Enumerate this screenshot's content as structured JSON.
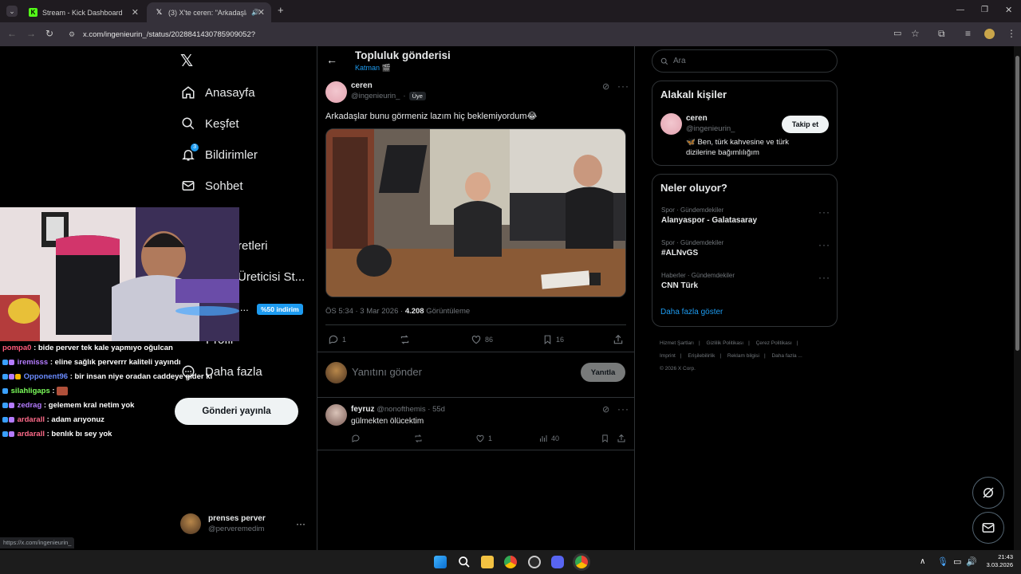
{
  "browser": {
    "tabs": [
      {
        "label": "Stream - Kick Dashboard",
        "active": false
      },
      {
        "label": "(3) X'te ceren: \"Arkadaşlar b",
        "active": true
      }
    ],
    "url": "x.com/ingenieurin_/status/2028841430785909052?",
    "status_url": "https://x.com/ingenieurin_"
  },
  "sidebar": {
    "items": [
      {
        "label": "Anasayfa",
        "icon": "home-icon"
      },
      {
        "label": "Keşfet",
        "icon": "search-icon"
      },
      {
        "label": "Bildirimler",
        "icon": "bell-icon",
        "badge": "3"
      },
      {
        "label": "Sohbet",
        "icon": "mail-icon"
      },
      {
        "label": "retleri"
      },
      {
        "label": "Üreticisi St..."
      },
      {
        "label": "l..."
      },
      {
        "label": "Profil"
      },
      {
        "label": "Daha fazla",
        "icon": "more-circle-icon"
      }
    ],
    "premium_badge": "%50 indirim",
    "post_button": "Gönderi yayınla",
    "account": {
      "name": "prenses perver",
      "handle": "@perveremedim"
    }
  },
  "header": {
    "title": "Topluluk gönderisi",
    "subtitle": "Katman 🎬"
  },
  "post": {
    "name": "ceren",
    "handle": "@ingenieurin_",
    "sep": "·",
    "member_badge": "Üye",
    "text": "Arkadaşlar bunu görmeniz lazım hiç beklemiyordum😂",
    "time": "ÖS 5:34 · 3 Mar 2026 ·",
    "views_count": "4.208",
    "views_label": "Görüntüleme",
    "replies": "1",
    "likes": "86",
    "bookmarks": "16"
  },
  "reply_box": {
    "placeholder": "Yanıtını gönder",
    "button": "Yanıtla"
  },
  "reply": {
    "name": "feyruz",
    "handle": "@nonofthemis · 55d",
    "text": "gülmekten ölücektim",
    "likes": "1",
    "views": "40"
  },
  "right": {
    "search_placeholder": "Ara",
    "related_title": "Alakalı kişiler",
    "related": {
      "name": "ceren",
      "handle": "@ingenieurin_",
      "bio": "🦋 Ben, türk kahvesine ve türk dizilerine bağımlılığım",
      "follow": "Takip et"
    },
    "trends_title": "Neler oluyor?",
    "trends": [
      {
        "meta": "Spor · Gündemdekiler",
        "name": "Alanyaspor - Galatasaray"
      },
      {
        "meta": "Spor · Gündemdekiler",
        "name": "#ALNvGS"
      },
      {
        "meta": "Haberler · Gündemdekiler",
        "name": "CNN Türk"
      }
    ],
    "show_more": "Daha fazla göster",
    "footer": [
      "Hizmet Şartları",
      "Gizlilik Politikası",
      "Çerez Politikası",
      "Imprint",
      "Erişilebilirlik",
      "Reklam bilgisi",
      "Daha fazla ...",
      "© 2026 X Corp."
    ]
  },
  "chat": [
    {
      "user": "pompa0",
      "color": "#ff5b7a",
      "msg": " : bide perver tek kale yapmıyo oğulcan"
    },
    {
      "user": "iremisss",
      "color": "#b47bff",
      "msg": " : eline sağlık perverrr kaliteli yayındı"
    },
    {
      "user": "Opponent96",
      "color": "#6a8bff",
      "msg": " : bir insan niye oradan caddeye gider ki"
    },
    {
      "user": "silahligaps",
      "color": "#7cff5b",
      "msg": " : "
    },
    {
      "user": "zedrag",
      "color": "#b47bff",
      "msg": " : gelemem kral netim yok"
    },
    {
      "user": "ardarall",
      "color": "#ff6b8a",
      "msg": " : adam arıyonuz"
    },
    {
      "user": "ardarall",
      "color": "#ff6b8a",
      "msg": " : benlık bı sey yok"
    }
  ],
  "clock": {
    "time": "21:43",
    "date": "3.03.2026"
  },
  "colors": {
    "accent": "#1d9bf0",
    "border": "#2f3336",
    "muted": "#71767b"
  }
}
